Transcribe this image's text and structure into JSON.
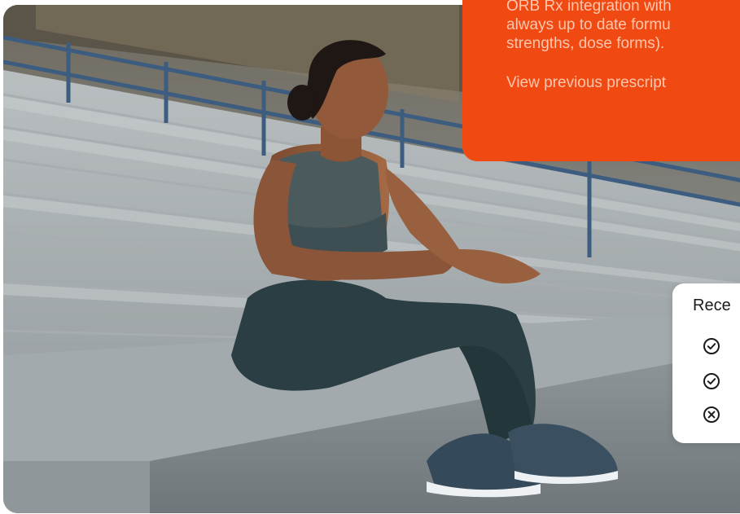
{
  "promo_card": {
    "description_lines": [
      "ORB Rx integration with",
      "always up to date formu",
      "strengths, dose forms)."
    ],
    "link_text": "View previous prescript",
    "background_color": "#f04a12",
    "text_color": "#ffc6ad"
  },
  "recent_card": {
    "title": "Rece",
    "items": [
      {
        "icon": "check-circle-icon",
        "status": "success"
      },
      {
        "icon": "check-circle-icon",
        "status": "success"
      },
      {
        "icon": "x-circle-icon",
        "status": "failed"
      }
    ]
  },
  "hero_image": {
    "alt": "Athlete sitting on stadium bleachers",
    "icon": "hero-photo"
  }
}
